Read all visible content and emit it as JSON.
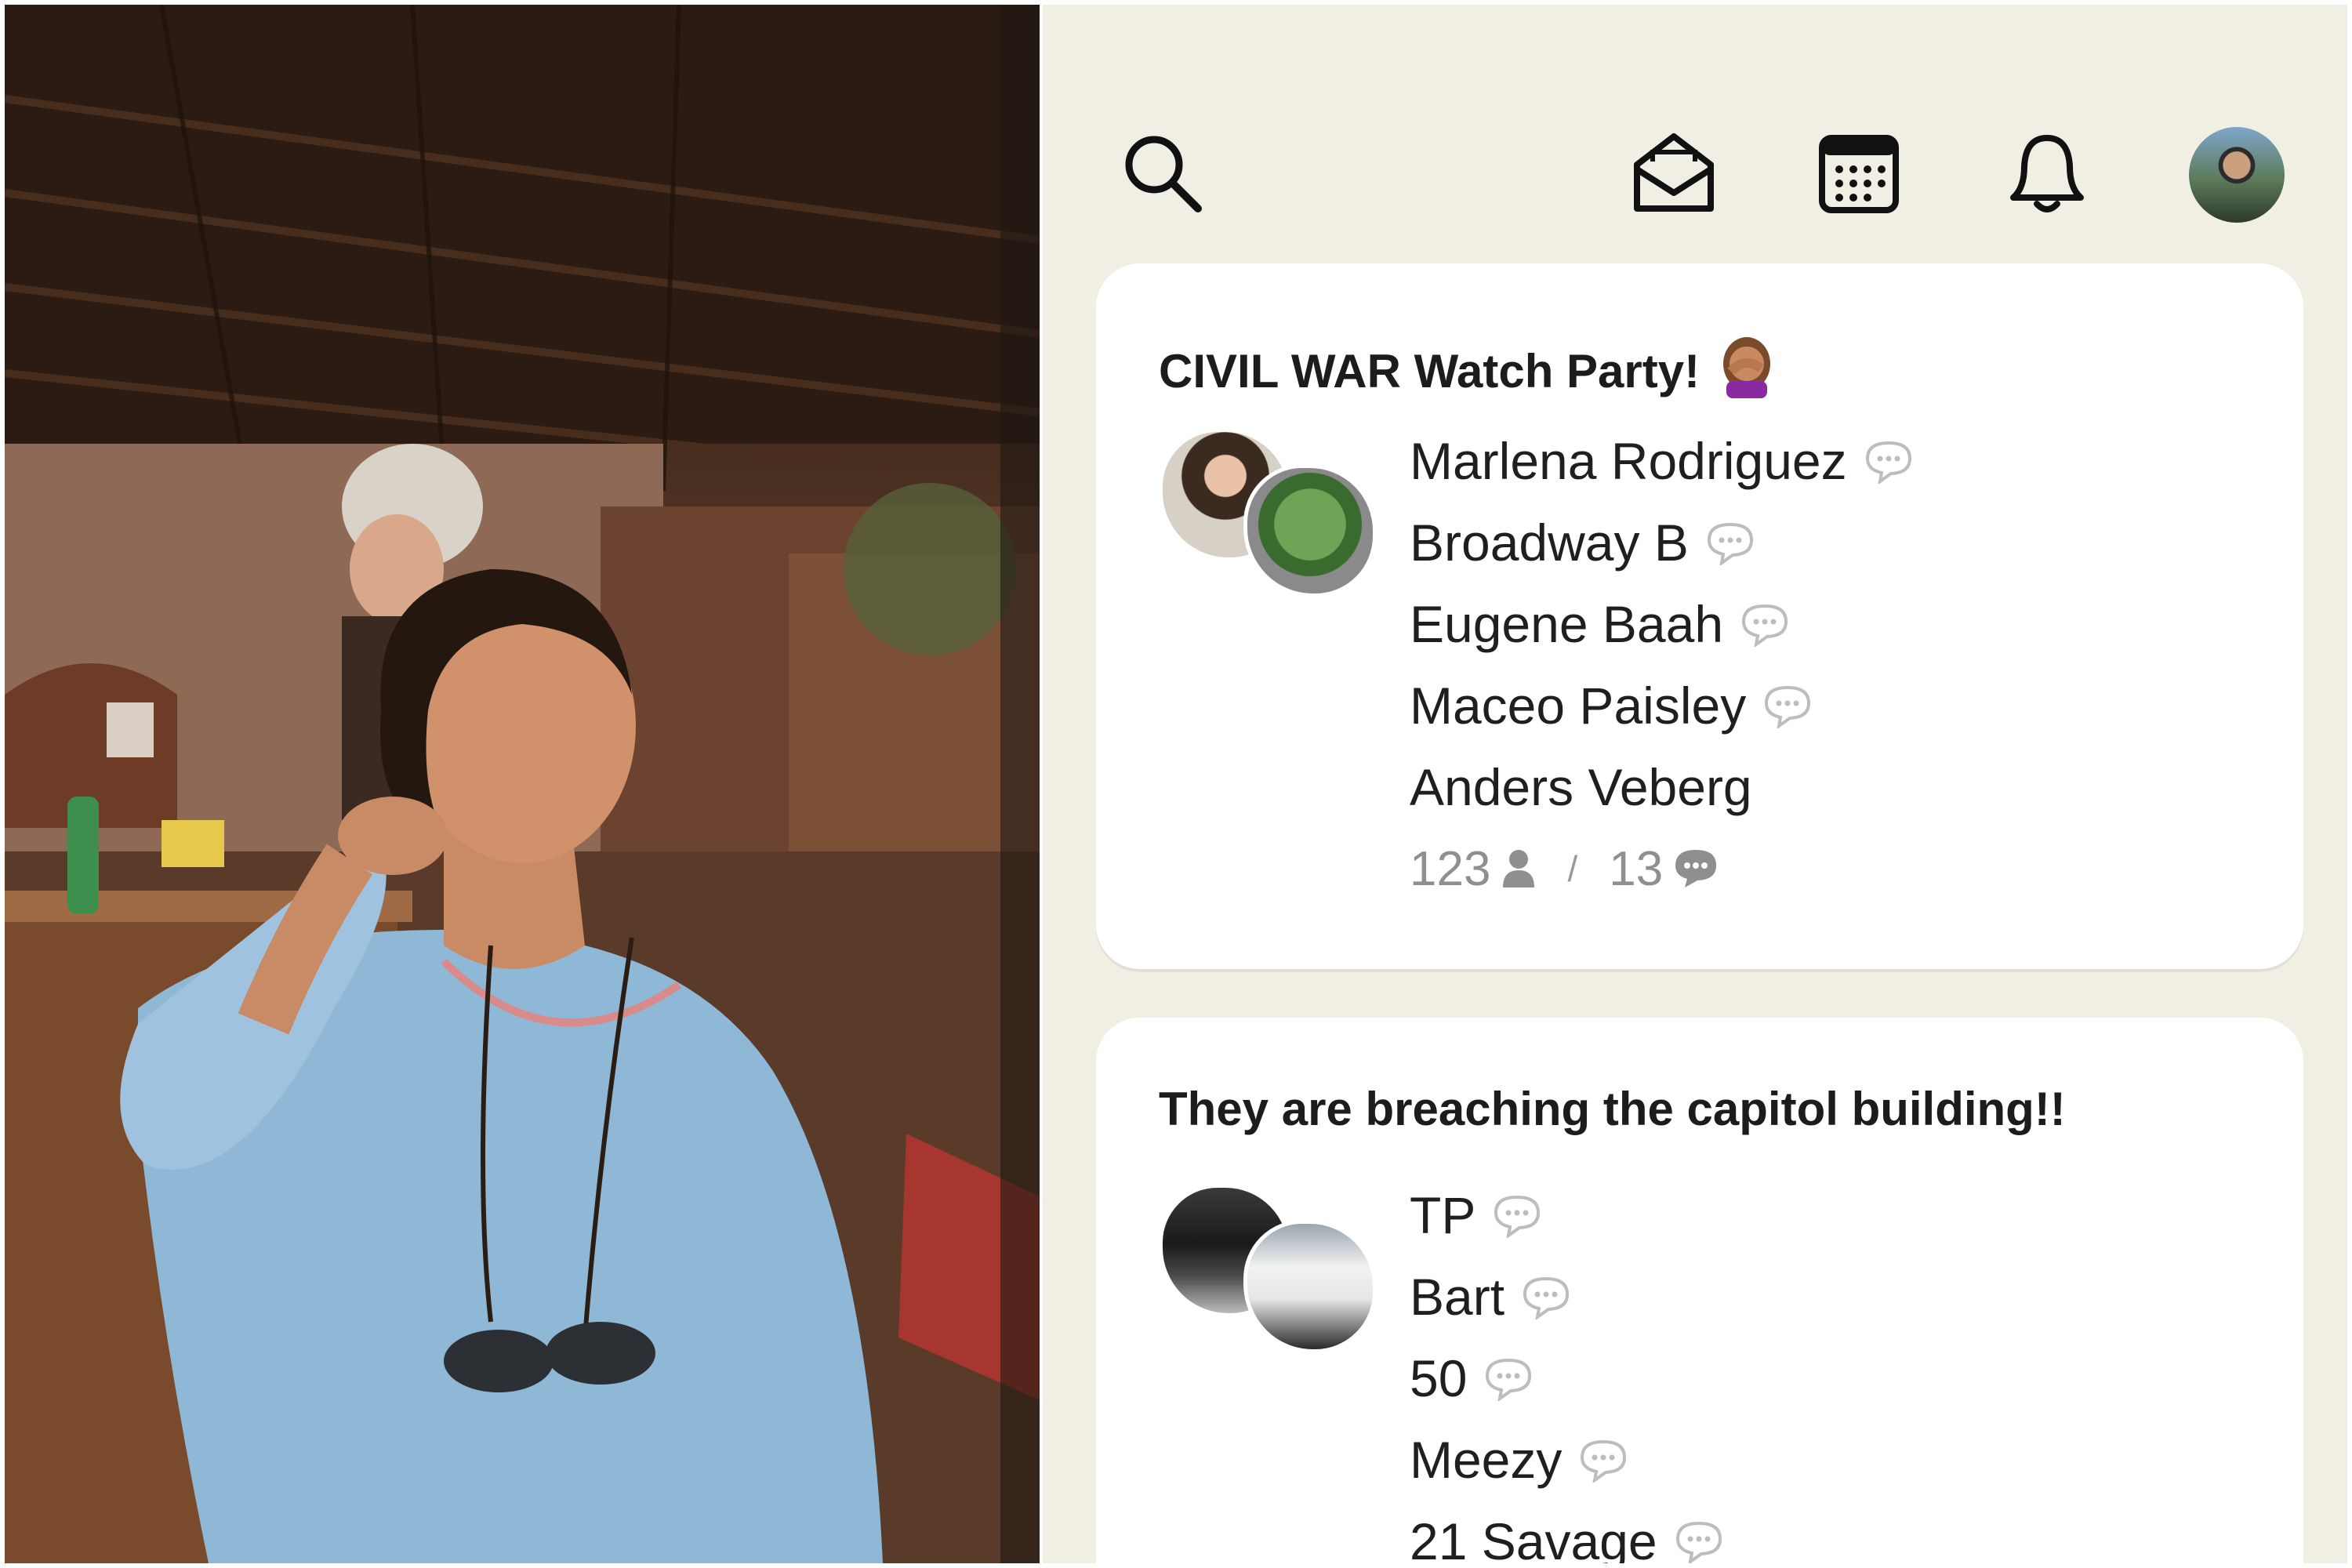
{
  "colors": {
    "app_background": "#f1efe4",
    "card_background": "#ffffff",
    "text_primary": "#1f1f1f",
    "text_muted": "#8f8f8f"
  },
  "topbar": {
    "icons": [
      "search-icon",
      "invite-envelope-icon",
      "calendar-icon",
      "bell-icon",
      "profile-avatar"
    ]
  },
  "rooms": [
    {
      "title": "CIVIL WAR Watch Party!",
      "title_emoji": "woman-facepalming-emoji",
      "speakers": [
        {
          "name": "Marlena Rodriguez",
          "speaking_icon": true
        },
        {
          "name": "Broadway B",
          "speaking_icon": true
        },
        {
          "name": "Eugene Baah",
          "speaking_icon": true
        },
        {
          "name": "Maceo Paisley",
          "speaking_icon": true
        },
        {
          "name": "Anders Veberg",
          "speaking_icon": false
        }
      ],
      "listeners": "123",
      "separator": "/",
      "speakers_count": "13"
    },
    {
      "title": "They are breaching the capitol building!!",
      "speakers": [
        {
          "name": "TP",
          "speaking_icon": true
        },
        {
          "name": "Bart",
          "speaking_icon": true
        },
        {
          "name": "50",
          "speaking_icon": true
        },
        {
          "name": "Meezy",
          "speaking_icon": true
        },
        {
          "name": "21 Savage",
          "speaking_icon": true
        }
      ]
    }
  ]
}
